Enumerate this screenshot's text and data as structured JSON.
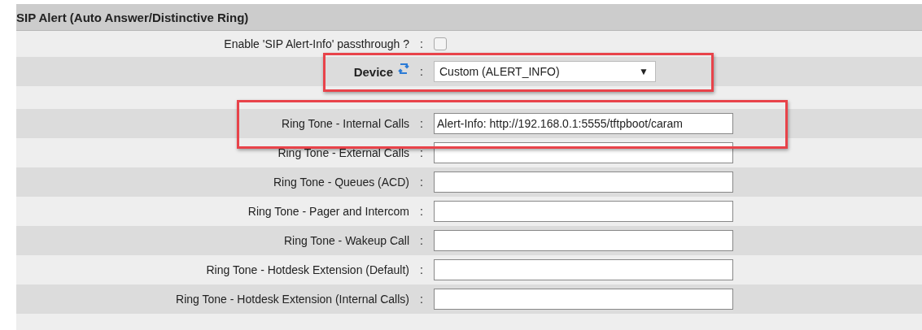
{
  "section": {
    "title": "SIP Alert (Auto Answer/Distinctive Ring)"
  },
  "rows": [
    {
      "kind": "checkbox",
      "label": "Enable 'SIP Alert-Info' passthrough ?",
      "separator": ":",
      "checked": false
    },
    {
      "kind": "select",
      "label": "Device",
      "separator": ":",
      "value": "Custom (ALERT_INFO)",
      "arrow": "▼"
    },
    {
      "kind": "blank"
    },
    {
      "kind": "text",
      "label": "Ring Tone - Internal Calls",
      "separator": ":",
      "value": "Alert-Info: http://192.168.0.1:5555/tftpboot/caram"
    },
    {
      "kind": "text",
      "label": "Ring Tone - External Calls",
      "separator": ":"
    },
    {
      "kind": "text",
      "label": "Ring Tone - Queues (ACD)",
      "separator": ":"
    },
    {
      "kind": "text",
      "label": "Ring Tone - Pager and Intercom",
      "separator": ":"
    },
    {
      "kind": "text",
      "label": "Ring Tone - Wakeup Call",
      "separator": ":"
    },
    {
      "kind": "text",
      "label": "Ring Tone - Hotdesk Extension (Default)",
      "separator": ":"
    },
    {
      "kind": "text",
      "label": "Ring Tone - Hotdesk Extension (Internal Calls)",
      "separator": ":"
    }
  ]
}
